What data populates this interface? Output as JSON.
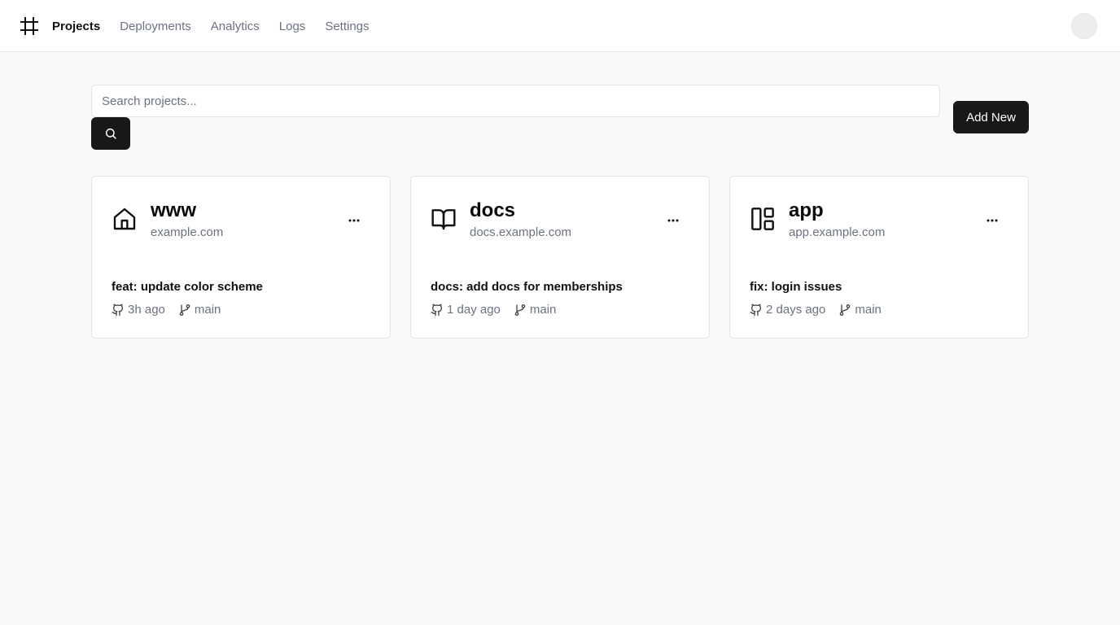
{
  "nav": {
    "items": [
      {
        "label": "Projects",
        "active": true
      },
      {
        "label": "Deployments",
        "active": false
      },
      {
        "label": "Analytics",
        "active": false
      },
      {
        "label": "Logs",
        "active": false
      },
      {
        "label": "Settings",
        "active": false
      }
    ]
  },
  "search": {
    "placeholder": "Search projects...",
    "value": ""
  },
  "actions": {
    "add_label": "Add New"
  },
  "projects": [
    {
      "icon": "home-icon",
      "name": "www",
      "domain": "example.com",
      "commit": "feat: update color scheme",
      "time": "3h ago",
      "branch": "main"
    },
    {
      "icon": "book-open-icon",
      "name": "docs",
      "domain": "docs.example.com",
      "commit": "docs: add docs for memberships",
      "time": "1 day ago",
      "branch": "main"
    },
    {
      "icon": "layout-panel-icon",
      "name": "app",
      "domain": "app.example.com",
      "commit": "fix: login issues",
      "time": "2 days ago",
      "branch": "main"
    }
  ],
  "colors": {
    "background": "#f8f9f9",
    "primary_button": "#18181b",
    "muted_text": "#6b7280",
    "border": "#e2e4e8"
  }
}
